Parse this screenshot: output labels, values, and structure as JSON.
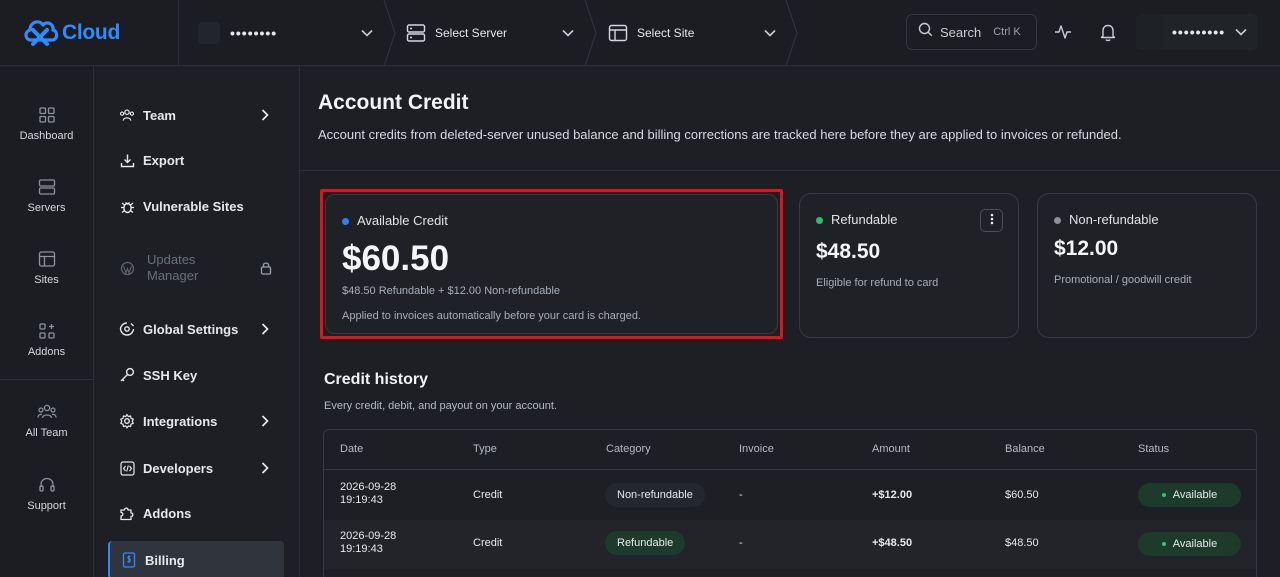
{
  "brand": {
    "name": "Cloud",
    "accent": "#2f8cff"
  },
  "topbar": {
    "account_masked": "••••••••",
    "server_label": "Select Server",
    "site_label": "Select Site",
    "search_label": "Search",
    "search_shortcut": "Ctrl K",
    "user_masked": "•••••••••"
  },
  "rail": {
    "items": [
      {
        "label": "Dashboard",
        "icon": "dashboard-icon"
      },
      {
        "label": "Servers",
        "icon": "servers-icon"
      },
      {
        "label": "Sites",
        "icon": "sites-icon"
      },
      {
        "label": "Addons",
        "icon": "addons-icon"
      },
      {
        "label": "All Team",
        "icon": "team-icon"
      },
      {
        "label": "Support",
        "icon": "headset-icon"
      }
    ]
  },
  "menu": {
    "items": [
      {
        "label": "Team",
        "icon": "team-icon",
        "chevron": true
      },
      {
        "label": "Export",
        "icon": "download-icon"
      },
      {
        "label": "Vulnerable Sites",
        "icon": "bug-icon"
      },
      {
        "label": "Updates Manager",
        "icon": "wordpress-icon",
        "disabled": true,
        "lock": true
      },
      {
        "label": "Global Settings",
        "icon": "settings-icon",
        "chevron": true
      },
      {
        "label": "SSH Key",
        "icon": "key-icon"
      },
      {
        "label": "Integrations",
        "icon": "gear-icon",
        "chevron": true
      },
      {
        "label": "Developers",
        "icon": "code-icon",
        "chevron": true
      },
      {
        "label": "Addons",
        "icon": "puzzle-icon"
      },
      {
        "label": "Billing",
        "icon": "receipt-icon",
        "active": true
      }
    ]
  },
  "page": {
    "title": "Account Credit",
    "description": "Account credits from deleted-server unused balance and billing corrections are tracked here before they are applied to invoices or refunded."
  },
  "cards": {
    "available": {
      "label": "Available Credit",
      "amount": "$60.50",
      "breakdown": "$48.50 Refundable + $12.00 Non-refundable",
      "note": "Applied to invoices automatically before your card is charged.",
      "dot_color": "#2f7dff"
    },
    "refundable": {
      "label": "Refundable",
      "amount": "$48.50",
      "note": "Eligible for refund to card",
      "dot_color": "#2fbf63"
    },
    "nonrefundable": {
      "label": "Non-refundable",
      "amount": "$12.00",
      "note": "Promotional / goodwill credit",
      "dot_color": "#8b9099"
    }
  },
  "history": {
    "title": "Credit history",
    "description": "Every credit, debit, and payout on your account.",
    "columns": [
      "Date",
      "Type",
      "Category",
      "Invoice",
      "Amount",
      "Balance",
      "Status"
    ],
    "rows": [
      {
        "date_line1": "2026-09-28",
        "date_line2": "19:19:43",
        "type": "Credit",
        "category": "Non-refundable",
        "invoice": "-",
        "amount": "+$12.00",
        "balance": "$60.50",
        "status": "Available"
      },
      {
        "date_line1": "2026-09-28",
        "date_line2": "19:19:43",
        "type": "Credit",
        "category": "Refundable",
        "invoice": "-",
        "amount": "+$48.50",
        "balance": "$48.50",
        "status": "Available"
      }
    ]
  }
}
